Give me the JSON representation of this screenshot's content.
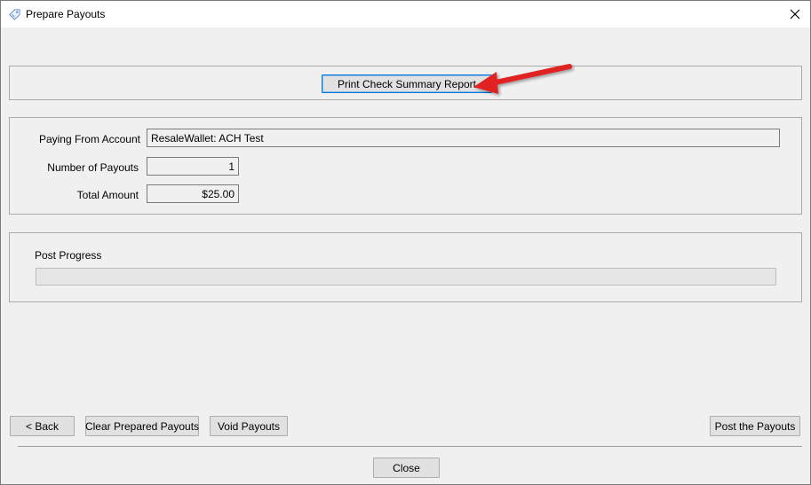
{
  "window": {
    "title": "Prepare Payouts"
  },
  "report": {
    "print_button_label": "Print Check Summary Report"
  },
  "summary": {
    "paying_from_label": "Paying From Account",
    "paying_from_value": "ResaleWallet: ACH Test",
    "num_payouts_label": "Number of Payouts",
    "num_payouts_value": "1",
    "total_amount_label": "Total Amount",
    "total_amount_value": "$25.00"
  },
  "progress": {
    "label": "Post Progress",
    "value": 0
  },
  "buttons": {
    "back": "< Back",
    "clear": "Clear Prepared Payouts",
    "void": "Void Payouts",
    "post": "Post the Payouts",
    "close": "Close"
  },
  "annotation": {
    "arrow_color": "#e02020"
  }
}
